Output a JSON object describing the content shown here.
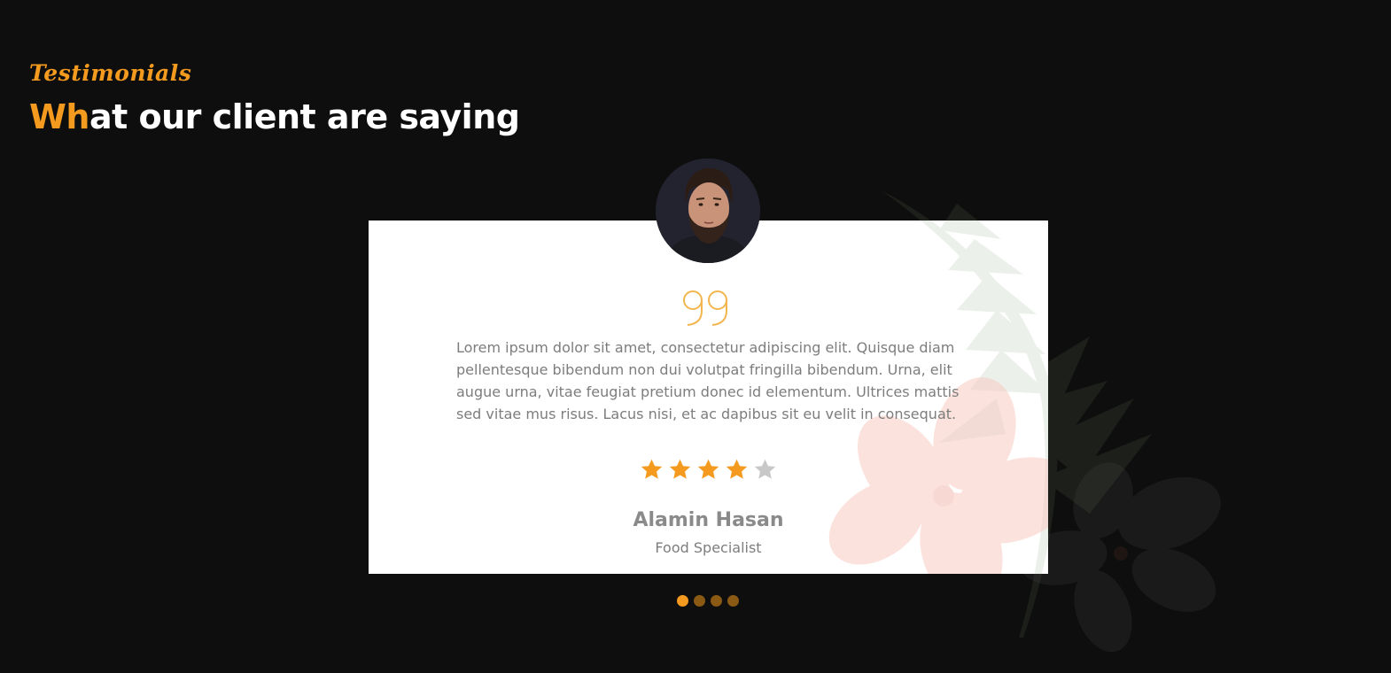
{
  "section": {
    "subtitle": "Testimonials",
    "heading_accent": "Wh",
    "heading_rest": "at our client are saying"
  },
  "testimonial": {
    "quote_icon": "quote-icon",
    "text": "Lorem ipsum dolor sit amet, consectetur adipiscing elit. Quisque diam pellentesque bibendum non dui volutpat fringilla bibendum. Urna, elit augue urna, vitae feugiat pretium donec id elementum. Ultrices mattis sed vitae mus risus. Lacus nisi, et ac dapibus sit eu velit in consequat.",
    "rating": 4,
    "rating_max": 5,
    "name": "Alamin Hasan",
    "role": "Food Specialist"
  },
  "carousel": {
    "total_slides": 4,
    "active_slide": 1
  },
  "colors": {
    "accent": "#f39a1f",
    "background": "#0e0e0e",
    "card": "#ffffff",
    "text_muted": "#7d7d7d",
    "star_empty": "#c8c8c8",
    "dot_inactive": "#8a5a14"
  }
}
